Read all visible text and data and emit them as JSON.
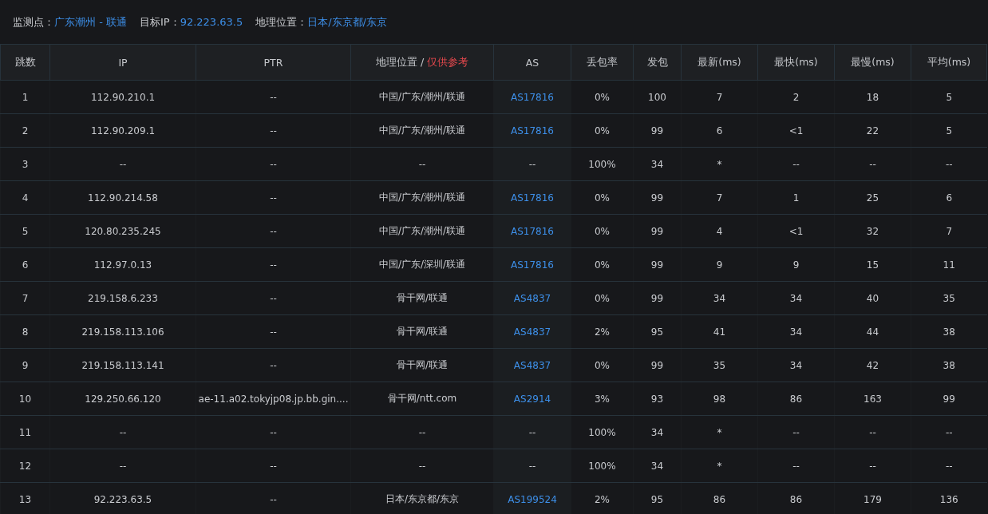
{
  "summary": [
    {
      "label": "监测点：",
      "value": "广东潮州 - 联通"
    },
    {
      "label": "目标IP：",
      "value": "92.223.63.5"
    },
    {
      "label": "地理位置：",
      "value": "日本/东京都/东京"
    }
  ],
  "table": {
    "columns": [
      {
        "label": "跳数"
      },
      {
        "label": "IP"
      },
      {
        "label": "PTR"
      },
      {
        "label": "地理位置 / ",
        "note": "仅供参考"
      },
      {
        "label": "AS"
      },
      {
        "label": "丢包率"
      },
      {
        "label": "发包"
      },
      {
        "label": "最新(ms)"
      },
      {
        "label": "最快(ms)"
      },
      {
        "label": "最慢(ms)"
      },
      {
        "label": "平均(ms)"
      }
    ],
    "rows": [
      {
        "cells": [
          "1",
          "112.90.210.1",
          "--",
          "中国/广东/潮州/联通",
          "AS17816",
          "0%",
          "100",
          "7",
          "2",
          "18",
          "5"
        ],
        "as_linked": true
      },
      {
        "cells": [
          "2",
          "112.90.209.1",
          "--",
          "中国/广东/潮州/联通",
          "AS17816",
          "0%",
          "99",
          "6",
          "<1",
          "22",
          "5"
        ],
        "as_linked": true
      },
      {
        "cells": [
          "3",
          "--",
          "--",
          "--",
          "--",
          "100%",
          "34",
          "*",
          "--",
          "--",
          "--"
        ],
        "as_linked": false
      },
      {
        "cells": [
          "4",
          "112.90.214.58",
          "--",
          "中国/广东/潮州/联通",
          "AS17816",
          "0%",
          "99",
          "7",
          "1",
          "25",
          "6"
        ],
        "as_linked": true
      },
      {
        "cells": [
          "5",
          "120.80.235.245",
          "--",
          "中国/广东/潮州/联通",
          "AS17816",
          "0%",
          "99",
          "4",
          "<1",
          "32",
          "7"
        ],
        "as_linked": true
      },
      {
        "cells": [
          "6",
          "112.97.0.13",
          "--",
          "中国/广东/深圳/联通",
          "AS17816",
          "0%",
          "99",
          "9",
          "9",
          "15",
          "11"
        ],
        "as_linked": true
      },
      {
        "cells": [
          "7",
          "219.158.6.233",
          "--",
          "骨干网/联通",
          "AS4837",
          "0%",
          "99",
          "34",
          "34",
          "40",
          "35"
        ],
        "as_linked": true
      },
      {
        "cells": [
          "8",
          "219.158.113.106",
          "--",
          "骨干网/联通",
          "AS4837",
          "2%",
          "95",
          "41",
          "34",
          "44",
          "38"
        ],
        "as_linked": true
      },
      {
        "cells": [
          "9",
          "219.158.113.141",
          "--",
          "骨干网/联通",
          "AS4837",
          "0%",
          "99",
          "35",
          "34",
          "42",
          "38"
        ],
        "as_linked": true
      },
      {
        "cells": [
          "10",
          "129.250.66.120",
          "ae-11.a02.tokyjp08.jp.bb.gin....",
          "骨干网/ntt.com",
          "AS2914",
          "3%",
          "93",
          "98",
          "86",
          "163",
          "99"
        ],
        "as_linked": true
      },
      {
        "cells": [
          "11",
          "--",
          "--",
          "--",
          "--",
          "100%",
          "34",
          "*",
          "--",
          "--",
          "--"
        ],
        "as_linked": false
      },
      {
        "cells": [
          "12",
          "--",
          "--",
          "--",
          "--",
          "100%",
          "34",
          "*",
          "--",
          "--",
          "--"
        ],
        "as_linked": false
      },
      {
        "cells": [
          "13",
          "92.223.63.5",
          "--",
          "日本/东京都/东京",
          "AS199524",
          "2%",
          "95",
          "86",
          "86",
          "179",
          "136"
        ],
        "as_linked": true
      }
    ]
  }
}
